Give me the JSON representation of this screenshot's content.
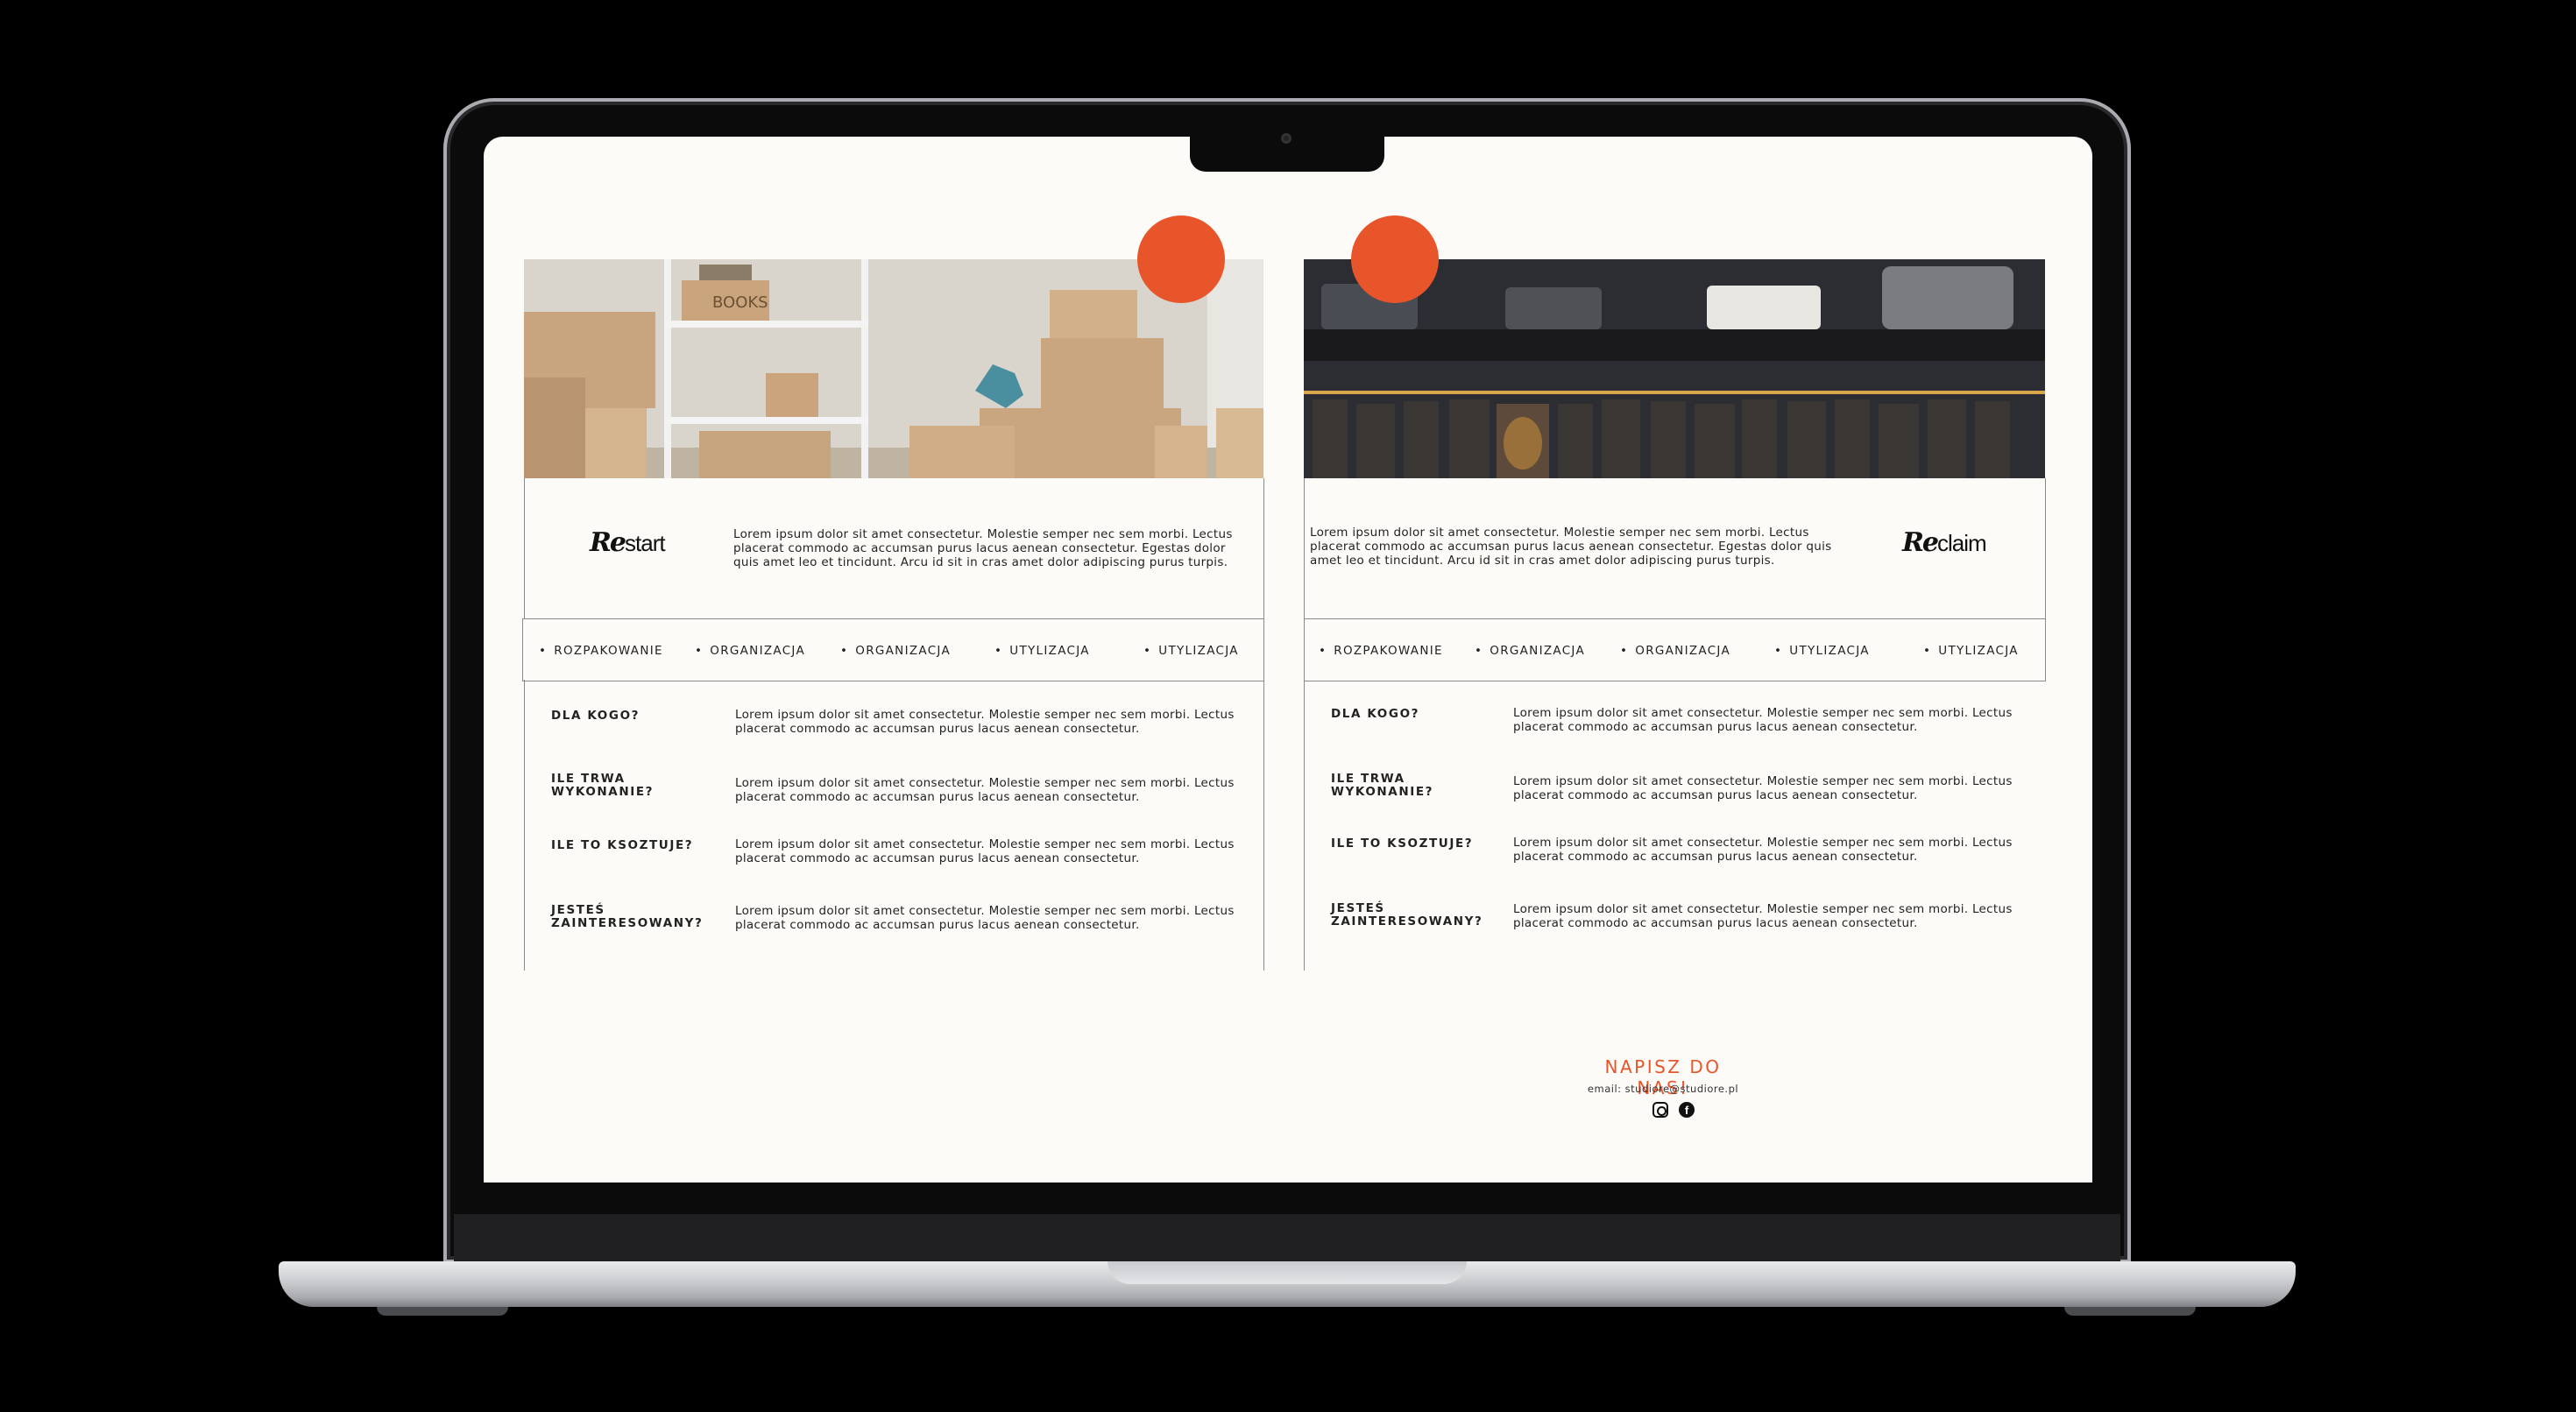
{
  "left_panel": {
    "brand_prefix": "Re",
    "brand_suffix": "start",
    "intro": "Lorem ipsum dolor sit amet consectetur. Molestie semper nec sem morbi. Lectus placerat commodo ac accumsan purus lacus aenean consectetur. Egestas dolor quis amet leo et tincidunt. Arcu id sit in cras amet dolor adipiscing purus turpis.",
    "tags": [
      "ROZPAKOWANIE",
      "ORGANIZACJA",
      "ORGANIZACJA",
      "UTYLIZACJA",
      "UTYLIZACJA"
    ],
    "faq": [
      {
        "q": "DLA KOGO?",
        "a": "Lorem ipsum dolor sit amet consectetur. Molestie semper nec sem morbi. Lectus placerat commodo ac accumsan purus lacus aenean consectetur."
      },
      {
        "q": "ILE TRWA WYKONANIE?",
        "a": "Lorem ipsum dolor sit amet consectetur. Molestie semper nec sem morbi. Lectus placerat commodo ac accumsan purus lacus aenean consectetur."
      },
      {
        "q": "ILE TO KSOZTUJE?",
        "a": "Lorem ipsum dolor sit amet consectetur. Molestie semper nec sem morbi. Lectus placerat commodo ac accumsan purus lacus aenean consectetur."
      },
      {
        "q": "JESTEŚ ZAINTERESOWANY?",
        "a": "Lorem ipsum dolor sit amet consectetur. Molestie semper nec sem morbi. Lectus placerat commodo ac accumsan purus lacus aenean consectetur."
      }
    ]
  },
  "right_panel": {
    "brand_prefix": "Re",
    "brand_suffix": "claim",
    "intro": "Lorem ipsum dolor sit amet consectetur. Molestie semper nec sem morbi. Lectus placerat commodo ac accumsan purus lacus aenean consectetur. Egestas dolor quis amet leo et tincidunt. Arcu id sit in cras amet dolor adipiscing purus turpis.",
    "tags": [
      "ROZPAKOWANIE",
      "ORGANIZACJA",
      "ORGANIZACJA",
      "UTYLIZACJA",
      "UTYLIZACJA"
    ],
    "faq": [
      {
        "q": "DLA KOGO?",
        "a": "Lorem ipsum dolor sit amet consectetur. Molestie semper nec sem morbi. Lectus placerat commodo ac accumsan purus lacus aenean consectetur."
      },
      {
        "q": "ILE TRWA WYKONANIE?",
        "a": "Lorem ipsum dolor sit amet consectetur. Molestie semper nec sem morbi. Lectus placerat commodo ac accumsan purus lacus aenean consectetur."
      },
      {
        "q": "ILE TO KSOZTUJE?",
        "a": "Lorem ipsum dolor sit amet consectetur. Molestie semper nec sem morbi. Lectus placerat commodo ac accumsan purus lacus aenean consectetur."
      },
      {
        "q": "JESTEŚ ZAINTERESOWANY?",
        "a": "Lorem ipsum dolor sit amet consectetur. Molestie semper nec sem morbi. Lectus placerat commodo ac accumsan purus lacus aenean consectetur."
      }
    ]
  },
  "images": {
    "left": "moving-boxes-photo",
    "right": "wardrobe-clothes-photo"
  },
  "contact": {
    "title": "NAPISZ DO NAS!",
    "email": "email: studiore@studiore.pl",
    "icons": [
      "instagram-icon",
      "facebook-icon"
    ]
  },
  "colors": {
    "accent": "#e8552b",
    "page_bg": "#fcfbf7",
    "text": "#222222"
  }
}
